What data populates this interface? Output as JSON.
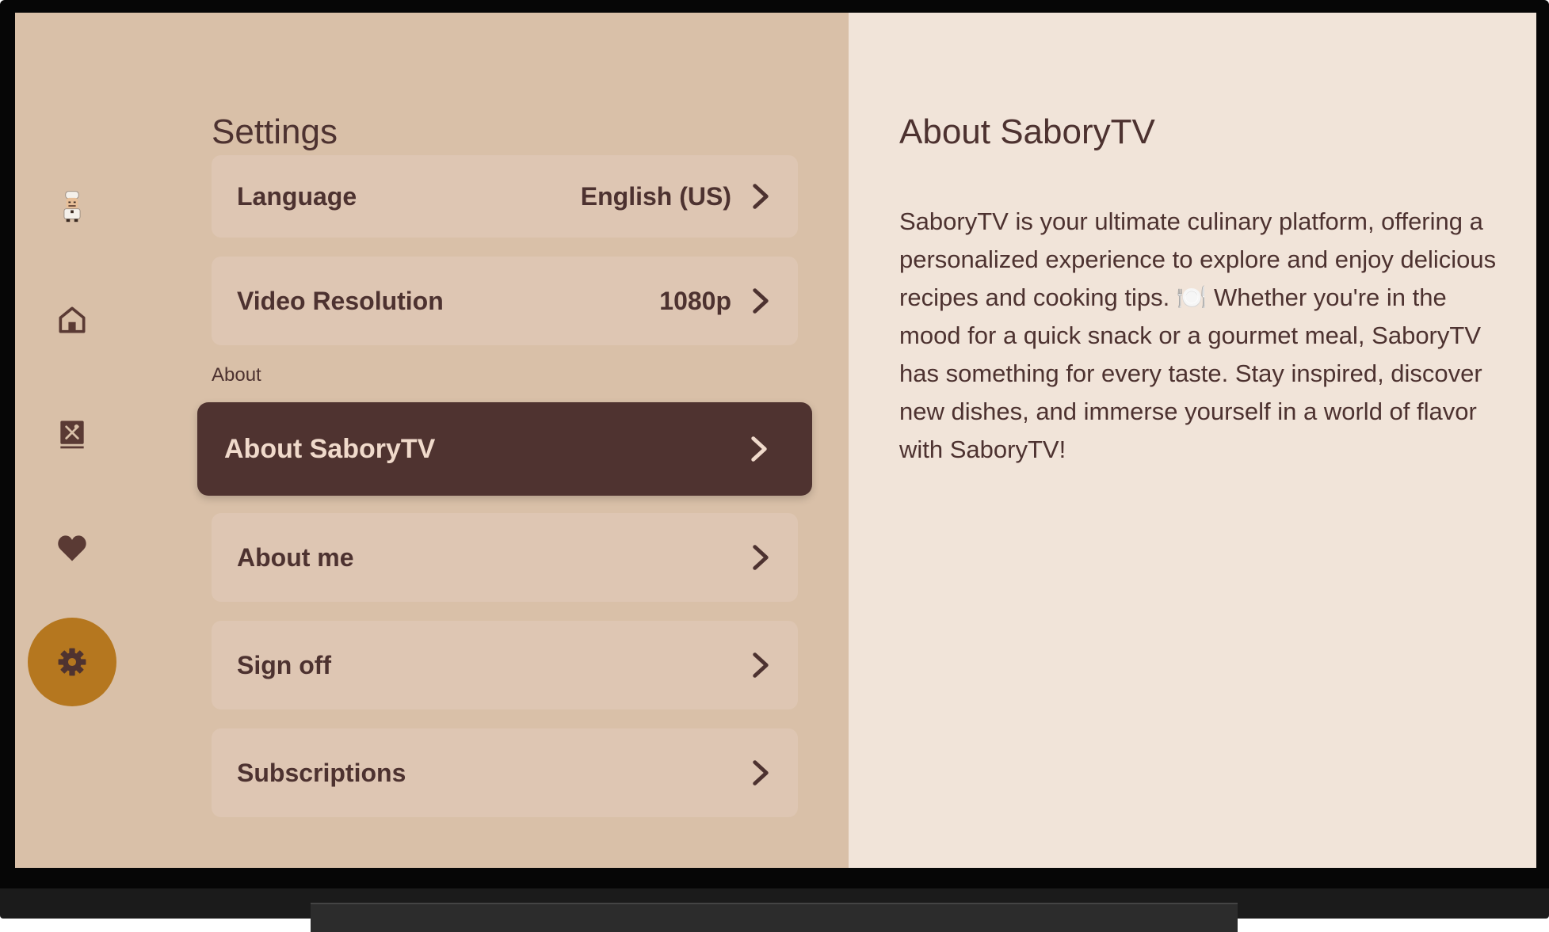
{
  "settings": {
    "title": "Settings",
    "language": {
      "label": "Language",
      "value": "English (US)"
    },
    "video_resolution": {
      "label": "Video Resolution",
      "value": "1080p"
    },
    "about_section_label": "About",
    "items": {
      "about_app": "About SaboryTV",
      "about_me": "About me",
      "sign_off": "Sign off",
      "subscriptions": "Subscriptions"
    }
  },
  "about_panel": {
    "title": "About SaboryTV",
    "body": "SaboryTV is your ultimate culinary platform, offering a personalized experience to explore and enjoy delicious recipes and cooking tips. 🍽️ Whether you're in the mood for a quick snack or a gourmet meal, SaboryTV has something for every taste. Stay inspired, discover new dishes, and immerse yourself in a world of flavor with SaboryTV!"
  },
  "nav": {
    "items": [
      "chef-avatar-icon",
      "home-icon",
      "recipe-book-icon",
      "heart-icon",
      "settings-gear-icon"
    ],
    "active": "settings-gear-icon"
  },
  "colors": {
    "left_panel": "#d9c0a8",
    "right_panel": "#f1e4d9",
    "row": "#dec6b3",
    "focused_row": "#4f3330",
    "accent": "#b5771f",
    "text": "#4d3230"
  }
}
